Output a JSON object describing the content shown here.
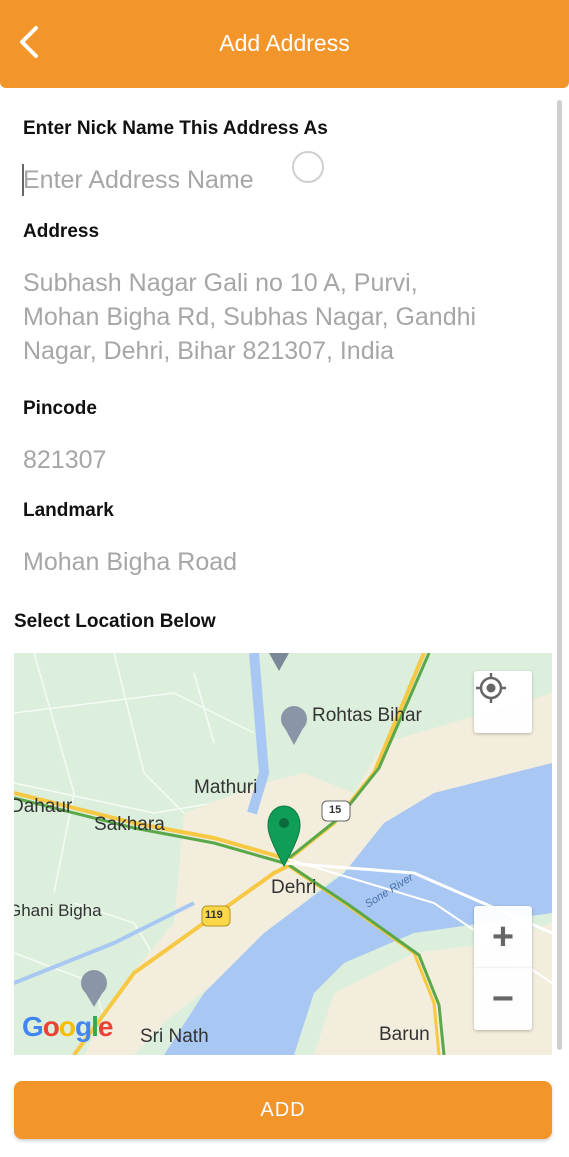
{
  "header": {
    "title": "Add Address",
    "back_icon": "back-arrow-icon",
    "color": "#F2962C"
  },
  "form": {
    "nickname_label": "Enter Nick Name This Address As",
    "nickname_placeholder": "Enter Address Name",
    "nickname_value": "",
    "address_label": "Address",
    "address_lines": [
      "Subhash Nagar Gali no 10 A, Purvi,",
      "Mohan Bigha Rd, Subhas Nagar, Gandhi",
      "Nagar, Dehri, Bihar 821307, India"
    ],
    "pincode_label": "Pincode",
    "pincode_value": "821307",
    "landmark_label": "Landmark",
    "landmark_value": "Mohan Bigha Road"
  },
  "map_section": {
    "label": "Select Location Below",
    "places": {
      "rohtas": "Rohtas Bihar",
      "mathuri": "Mathuri",
      "dahaur": "Dahaur",
      "sakhara": "Sakhara",
      "dehri": "Dehri",
      "ghani": "Ghani Bigha",
      "sri_nath": "Sri Nath",
      "barun": "Barun",
      "sone_river": "Sone River",
      "route_119": "119",
      "route_15": "15"
    },
    "logo": "Google",
    "controls": {
      "my_location_icon": "my-location-icon",
      "zoom_in": "+",
      "zoom_out": "−"
    }
  },
  "actions": {
    "add_label": "ADD"
  }
}
